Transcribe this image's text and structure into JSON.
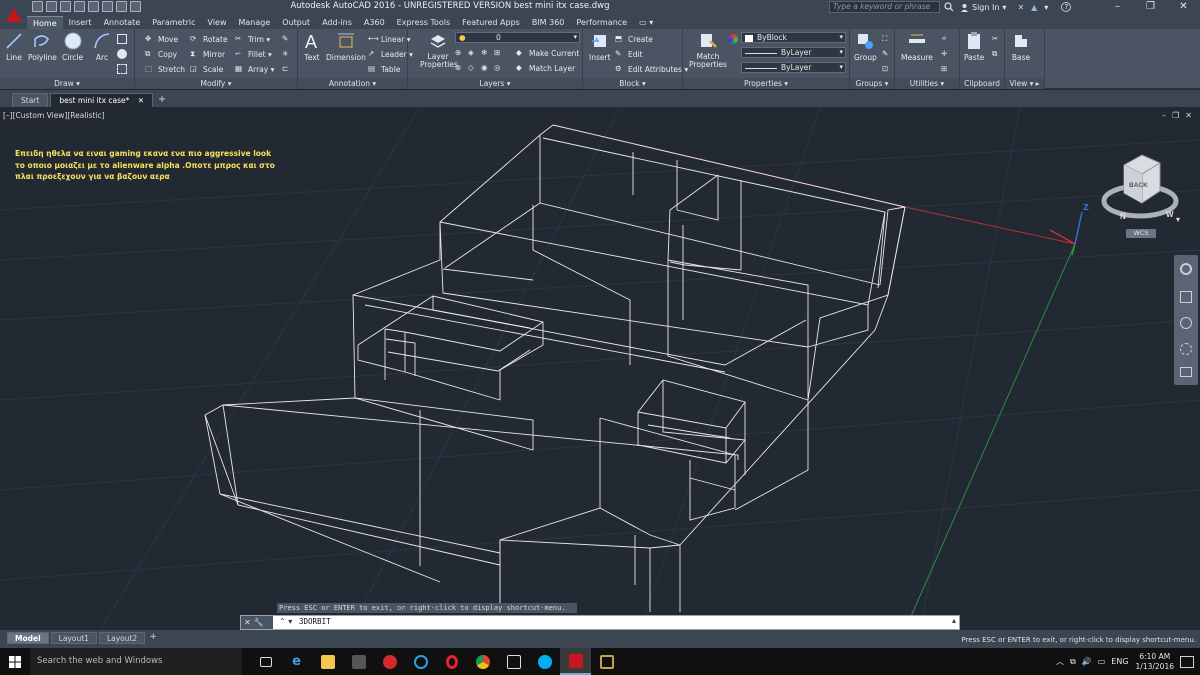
{
  "title_bar": {
    "title": "Autodesk AutoCAD 2016 - UNREGISTERED VERSION    best mini itx case.dwg",
    "search_placeholder": "Type a keyword or phrase",
    "sign_in": "Sign In",
    "help": "?",
    "minimize": "–",
    "restore": "❐",
    "close": "✕"
  },
  "ribbon_tabs": [
    "Home",
    "Insert",
    "Annotate",
    "Parametric",
    "View",
    "Manage",
    "Output",
    "Add-ins",
    "A360",
    "Express Tools",
    "Featured Apps",
    "BIM 360",
    "Performance",
    "▭ ▾"
  ],
  "ribbon": {
    "draw": {
      "title": "Draw ▾",
      "line": "Line",
      "polyline": "Polyline",
      "circle": "Circle",
      "arc": "Arc"
    },
    "modify": {
      "title": "Modify ▾",
      "move": "Move",
      "rotate": "Rotate",
      "trim": "Trim ▾",
      "copy": "Copy",
      "mirror": "Mirror",
      "fillet": "Fillet ▾",
      "stretch": "Stretch",
      "scale": "Scale",
      "array": "Array ▾"
    },
    "annotation": {
      "title": "Annotation ▾",
      "text": "Text",
      "dimension": "Dimension",
      "linear": "Linear ▾",
      "leader": "Leader ▾",
      "table": "Table"
    },
    "layers": {
      "title": "Layers ▾",
      "layer_properties": "Layer Properties",
      "layer_value": "0",
      "make_current": "Make Current",
      "match_layer": "Match Layer"
    },
    "block": {
      "title": "Block ▾",
      "insert": "Insert",
      "create": "Create",
      "edit": "Edit",
      "edit_attributes": "Edit Attributes ▾"
    },
    "properties": {
      "title": "Properties ▾",
      "match_properties": "Match Properties",
      "color": "ByBlock",
      "linetype": "ByLayer",
      "lineweight": "ByLayer"
    },
    "groups": {
      "title": "Groups ▾",
      "group": "Group"
    },
    "utilities": {
      "title": "Utilities ▾",
      "measure": "Measure"
    },
    "clipboard": {
      "title": "Clipboard",
      "paste": "Paste"
    },
    "view": {
      "title": "View ▾ ▸",
      "base": "Base"
    }
  },
  "doc_tabs": [
    "Start",
    "best mini itx case*"
  ],
  "viewport": {
    "label": "[–][Custom View][Realistic]",
    "controls": [
      "–",
      "❐",
      "✕"
    ],
    "annotation_lines": [
      "Επειδη ηθελα να ειναι gaming εκανα ενα πιο aggressive look",
      "το οποιο μοιαζει με το alienware alpha .Οποτε μπρος και στο",
      "πλαι προεξεχουν για να βαζουν αερα"
    ],
    "viewcube_face": "BACK",
    "compass_n": "N",
    "compass_w": "W",
    "wcs": "WCS",
    "axis_z": "Z"
  },
  "command": {
    "hint": "Press ESC or ENTER to exit, or right-click to display shortcut-menu.",
    "prompt": "⌃ ▾",
    "text": "3DORBIT"
  },
  "layout_tabs": [
    "Model",
    "Layout1",
    "Layout2"
  ],
  "status_text": "Press ESC or ENTER to exit, or right-click to display shortcut-menu.",
  "taskbar": {
    "search": "Search the web and Windows",
    "lang": "ENG",
    "time": "6:10 AM",
    "date": "1/13/2016"
  },
  "colors": {
    "title_bg": "#3c4552",
    "viewport_bg": "#222933",
    "annotation": "#f5e25a",
    "wire": "#e8e8e8",
    "autocad_red": "#c4161c"
  }
}
